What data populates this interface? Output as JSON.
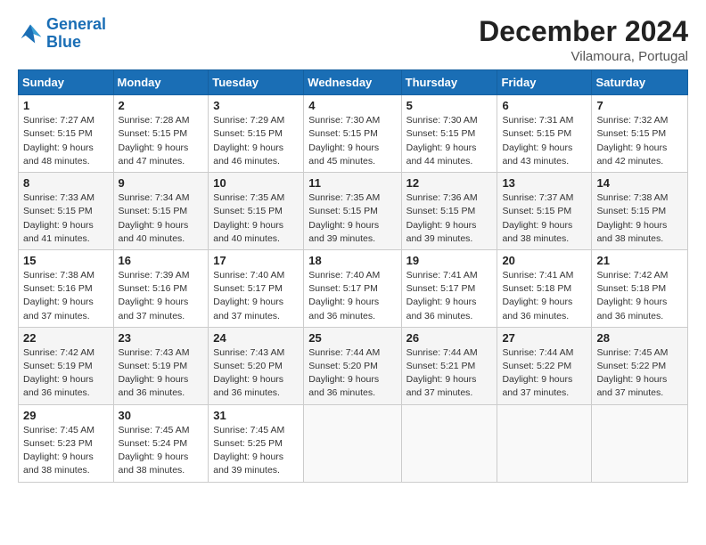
{
  "logo": {
    "line1": "General",
    "line2": "Blue"
  },
  "title": "December 2024",
  "location": "Vilamoura, Portugal",
  "headers": [
    "Sunday",
    "Monday",
    "Tuesday",
    "Wednesday",
    "Thursday",
    "Friday",
    "Saturday"
  ],
  "weeks": [
    [
      {
        "day": "1",
        "detail": "Sunrise: 7:27 AM\nSunset: 5:15 PM\nDaylight: 9 hours\nand 48 minutes."
      },
      {
        "day": "2",
        "detail": "Sunrise: 7:28 AM\nSunset: 5:15 PM\nDaylight: 9 hours\nand 47 minutes."
      },
      {
        "day": "3",
        "detail": "Sunrise: 7:29 AM\nSunset: 5:15 PM\nDaylight: 9 hours\nand 46 minutes."
      },
      {
        "day": "4",
        "detail": "Sunrise: 7:30 AM\nSunset: 5:15 PM\nDaylight: 9 hours\nand 45 minutes."
      },
      {
        "day": "5",
        "detail": "Sunrise: 7:30 AM\nSunset: 5:15 PM\nDaylight: 9 hours\nand 44 minutes."
      },
      {
        "day": "6",
        "detail": "Sunrise: 7:31 AM\nSunset: 5:15 PM\nDaylight: 9 hours\nand 43 minutes."
      },
      {
        "day": "7",
        "detail": "Sunrise: 7:32 AM\nSunset: 5:15 PM\nDaylight: 9 hours\nand 42 minutes."
      }
    ],
    [
      {
        "day": "8",
        "detail": "Sunrise: 7:33 AM\nSunset: 5:15 PM\nDaylight: 9 hours\nand 41 minutes."
      },
      {
        "day": "9",
        "detail": "Sunrise: 7:34 AM\nSunset: 5:15 PM\nDaylight: 9 hours\nand 40 minutes."
      },
      {
        "day": "10",
        "detail": "Sunrise: 7:35 AM\nSunset: 5:15 PM\nDaylight: 9 hours\nand 40 minutes."
      },
      {
        "day": "11",
        "detail": "Sunrise: 7:35 AM\nSunset: 5:15 PM\nDaylight: 9 hours\nand 39 minutes."
      },
      {
        "day": "12",
        "detail": "Sunrise: 7:36 AM\nSunset: 5:15 PM\nDaylight: 9 hours\nand 39 minutes."
      },
      {
        "day": "13",
        "detail": "Sunrise: 7:37 AM\nSunset: 5:15 PM\nDaylight: 9 hours\nand 38 minutes."
      },
      {
        "day": "14",
        "detail": "Sunrise: 7:38 AM\nSunset: 5:15 PM\nDaylight: 9 hours\nand 38 minutes."
      }
    ],
    [
      {
        "day": "15",
        "detail": "Sunrise: 7:38 AM\nSunset: 5:16 PM\nDaylight: 9 hours\nand 37 minutes."
      },
      {
        "day": "16",
        "detail": "Sunrise: 7:39 AM\nSunset: 5:16 PM\nDaylight: 9 hours\nand 37 minutes."
      },
      {
        "day": "17",
        "detail": "Sunrise: 7:40 AM\nSunset: 5:17 PM\nDaylight: 9 hours\nand 37 minutes."
      },
      {
        "day": "18",
        "detail": "Sunrise: 7:40 AM\nSunset: 5:17 PM\nDaylight: 9 hours\nand 36 minutes."
      },
      {
        "day": "19",
        "detail": "Sunrise: 7:41 AM\nSunset: 5:17 PM\nDaylight: 9 hours\nand 36 minutes."
      },
      {
        "day": "20",
        "detail": "Sunrise: 7:41 AM\nSunset: 5:18 PM\nDaylight: 9 hours\nand 36 minutes."
      },
      {
        "day": "21",
        "detail": "Sunrise: 7:42 AM\nSunset: 5:18 PM\nDaylight: 9 hours\nand 36 minutes."
      }
    ],
    [
      {
        "day": "22",
        "detail": "Sunrise: 7:42 AM\nSunset: 5:19 PM\nDaylight: 9 hours\nand 36 minutes."
      },
      {
        "day": "23",
        "detail": "Sunrise: 7:43 AM\nSunset: 5:19 PM\nDaylight: 9 hours\nand 36 minutes."
      },
      {
        "day": "24",
        "detail": "Sunrise: 7:43 AM\nSunset: 5:20 PM\nDaylight: 9 hours\nand 36 minutes."
      },
      {
        "day": "25",
        "detail": "Sunrise: 7:44 AM\nSunset: 5:20 PM\nDaylight: 9 hours\nand 36 minutes."
      },
      {
        "day": "26",
        "detail": "Sunrise: 7:44 AM\nSunset: 5:21 PM\nDaylight: 9 hours\nand 37 minutes."
      },
      {
        "day": "27",
        "detail": "Sunrise: 7:44 AM\nSunset: 5:22 PM\nDaylight: 9 hours\nand 37 minutes."
      },
      {
        "day": "28",
        "detail": "Sunrise: 7:45 AM\nSunset: 5:22 PM\nDaylight: 9 hours\nand 37 minutes."
      }
    ],
    [
      {
        "day": "29",
        "detail": "Sunrise: 7:45 AM\nSunset: 5:23 PM\nDaylight: 9 hours\nand 38 minutes."
      },
      {
        "day": "30",
        "detail": "Sunrise: 7:45 AM\nSunset: 5:24 PM\nDaylight: 9 hours\nand 38 minutes."
      },
      {
        "day": "31",
        "detail": "Sunrise: 7:45 AM\nSunset: 5:25 PM\nDaylight: 9 hours\nand 39 minutes."
      },
      {
        "day": "",
        "detail": ""
      },
      {
        "day": "",
        "detail": ""
      },
      {
        "day": "",
        "detail": ""
      },
      {
        "day": "",
        "detail": ""
      }
    ]
  ]
}
